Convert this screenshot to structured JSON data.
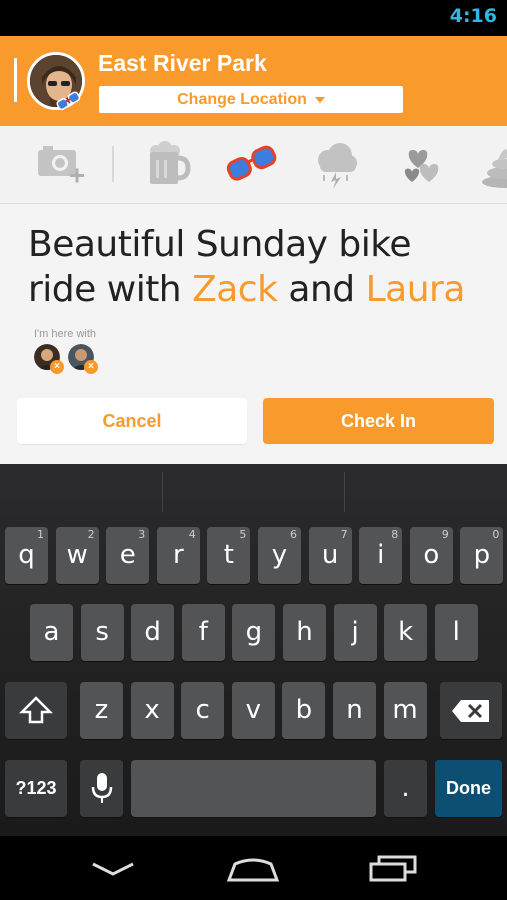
{
  "status": {
    "time": "4:16"
  },
  "header": {
    "venue_name": "East River Park",
    "change_location_label": "Change Location"
  },
  "stickers": [
    {
      "name": "camera-plus-icon"
    },
    {
      "name": "beer-mug-icon"
    },
    {
      "name": "sunglasses-icon"
    },
    {
      "name": "storm-cloud-icon"
    },
    {
      "name": "hearts-icon"
    },
    {
      "name": "poop-icon"
    }
  ],
  "compose": {
    "text_prefix": "Beautiful Sunday bike ride with ",
    "mention1": "Zack",
    "text_and": " and ",
    "mention2": "Laura",
    "here_with_label": "I'm here with",
    "cancel_label": "Cancel",
    "checkin_label": "Check In"
  },
  "keyboard": {
    "row1": [
      {
        "k": "q",
        "n": "1"
      },
      {
        "k": "w",
        "n": "2"
      },
      {
        "k": "e",
        "n": "3"
      },
      {
        "k": "r",
        "n": "4"
      },
      {
        "k": "t",
        "n": "5"
      },
      {
        "k": "y",
        "n": "6"
      },
      {
        "k": "u",
        "n": "7"
      },
      {
        "k": "i",
        "n": "8"
      },
      {
        "k": "o",
        "n": "9"
      },
      {
        "k": "p",
        "n": "0"
      }
    ],
    "row2": [
      "a",
      "s",
      "d",
      "f",
      "g",
      "h",
      "j",
      "k",
      "l"
    ],
    "row3": [
      "z",
      "x",
      "c",
      "v",
      "b",
      "n",
      "m"
    ],
    "symbols_label": "?123",
    "period_label": ".",
    "done_label": "Done"
  },
  "colors": {
    "accent": "#f89a2c",
    "status_time": "#33b5e5",
    "done_key": "#0d4f73"
  }
}
